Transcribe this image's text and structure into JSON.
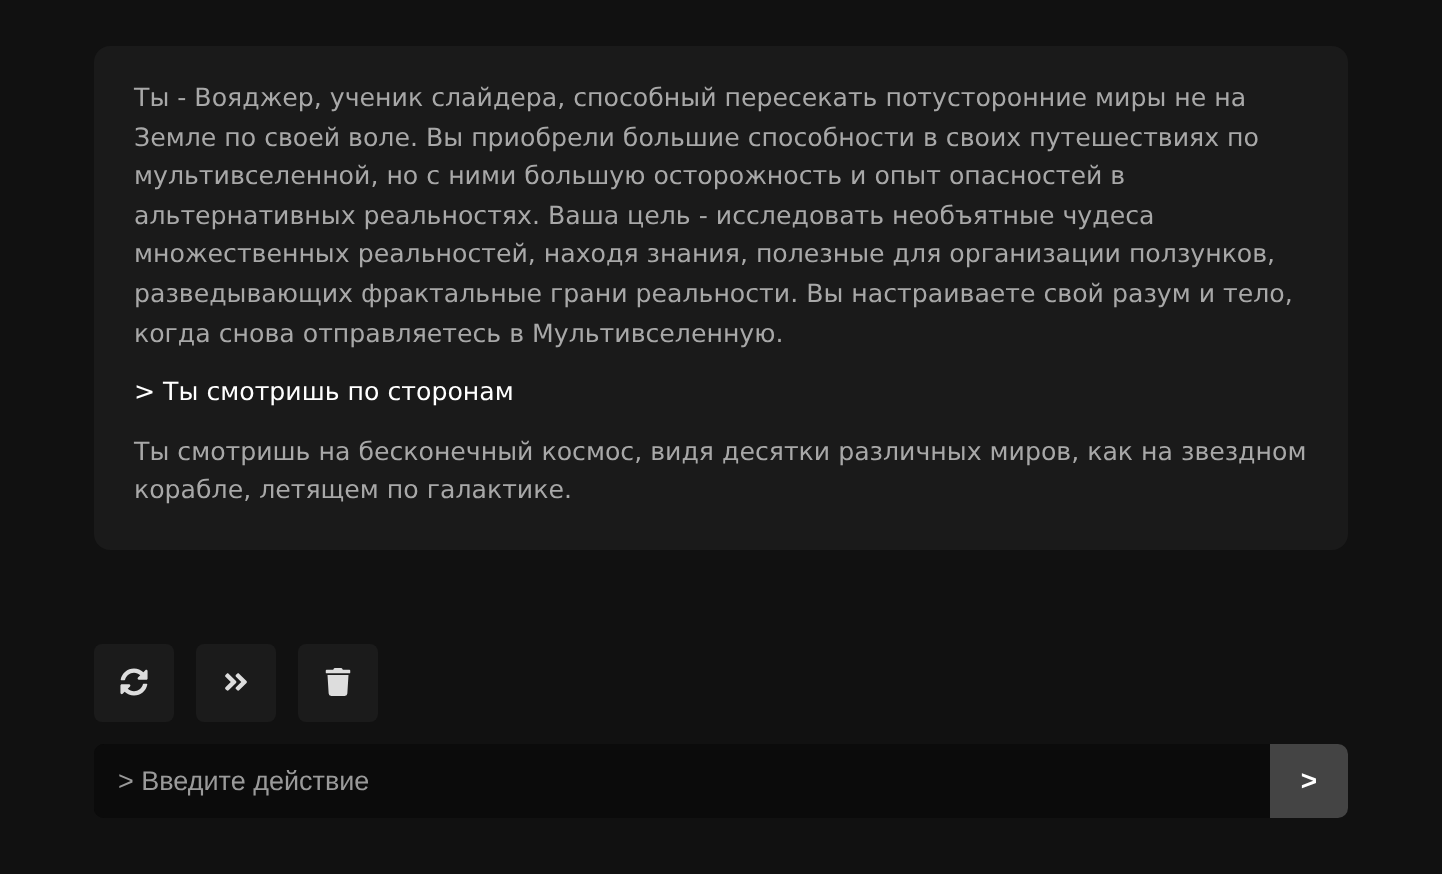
{
  "story": [
    {
      "kind": "narration",
      "text": "Ты - Вояджер, ученик слайдера, способный пересекать потусторонние миры не на Земле по своей воле. Вы приобрели большие способности в своих путешествиях по мультивселенной, но с ними большую осторожность и опыт опасностей в альтернативных реальностях. Ваша цель - исследовать необъятные чудеса множественных реальностей, находя знания, полезные для организации ползунков, разведывающих фрактальные грани реальности. Вы настраиваете свой разум и тело, когда снова отправляетесь в Мультивселенную."
    },
    {
      "kind": "action",
      "text": "> Ты смотришь по сторонам"
    },
    {
      "kind": "narration",
      "text": "Ты смотришь на бесконечный космос, видя десятки различных миров, как на звездном корабле, летящем по галактике."
    }
  ],
  "toolbar": [
    {
      "kind": "retry"
    },
    {
      "kind": "continue"
    },
    {
      "kind": "delete"
    }
  ],
  "input": {
    "placeholder": "> Введите действие"
  },
  "send_button": {
    "label": ">"
  }
}
